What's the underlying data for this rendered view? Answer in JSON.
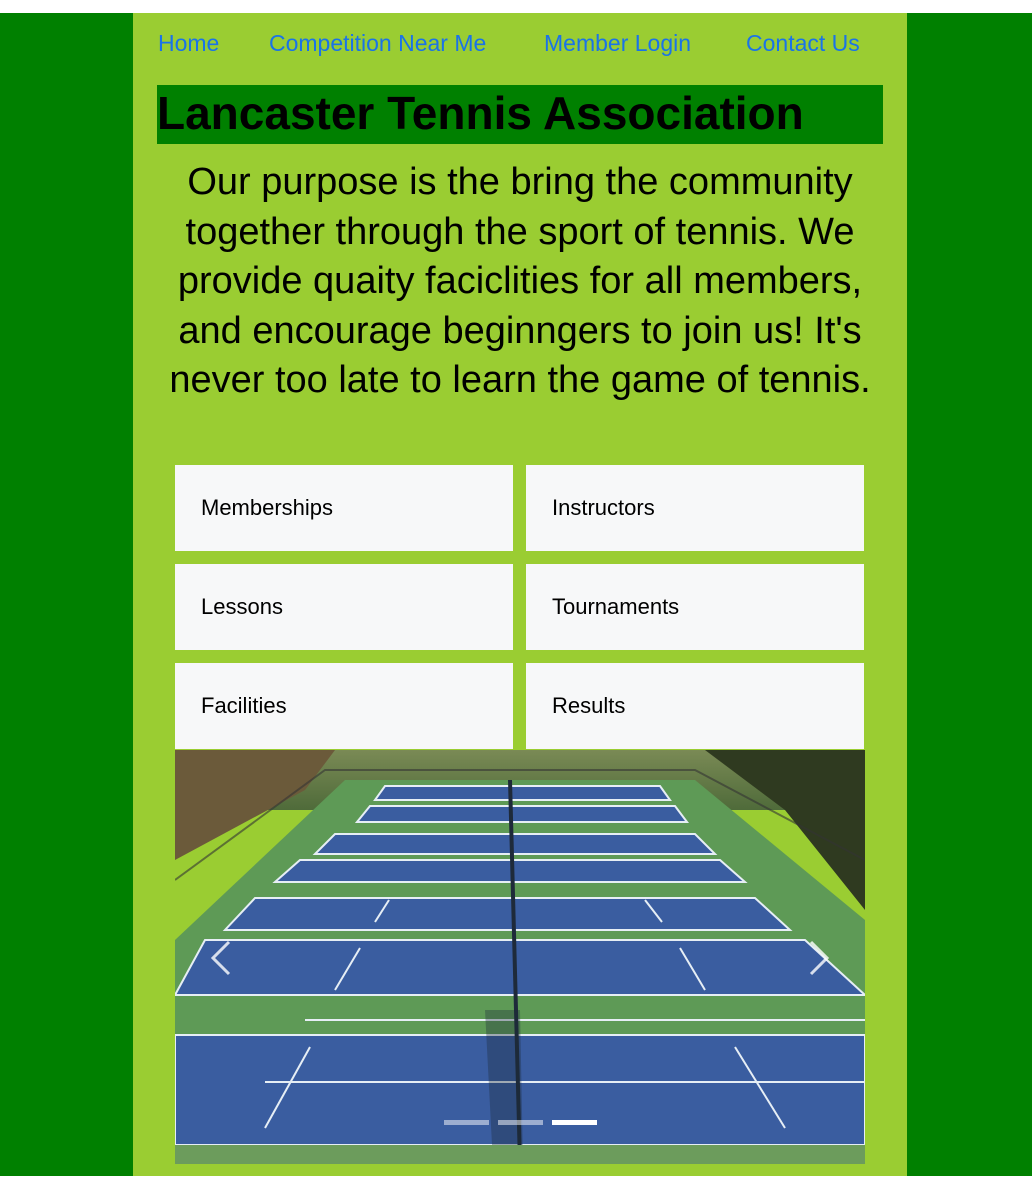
{
  "nav": {
    "items": [
      {
        "label": "Home"
      },
      {
        "label": "Competition Near Me"
      },
      {
        "label": "Member Login"
      },
      {
        "label": "Contact Us"
      }
    ]
  },
  "header": {
    "title": "Lancaster Tennis Association"
  },
  "main": {
    "purpose": "Our purpose is the bring the community together through the sport of tennis. We provide quaity faciclities for all members, and encourage beginngers to join us! It's never too late to learn the game of tennis.",
    "cards": [
      {
        "label": "Memberships"
      },
      {
        "label": "Instructors"
      },
      {
        "label": "Lessons"
      },
      {
        "label": "Tournaments"
      },
      {
        "label": "Facilities"
      },
      {
        "label": "Results"
      }
    ]
  },
  "carousel": {
    "slide_count": 3,
    "active_slide": 3,
    "image_alt_icon": "tennis-courts-photo",
    "prev_icon": "chevron-left-icon",
    "next_icon": "chevron-right-icon"
  },
  "colors": {
    "outer_bg": "#008000",
    "content_bg": "#9acd32",
    "link": "#1a73e8",
    "card_bg": "#f7f8f9",
    "court_blue": "#3a5da0",
    "court_green": "#5e9a56"
  }
}
